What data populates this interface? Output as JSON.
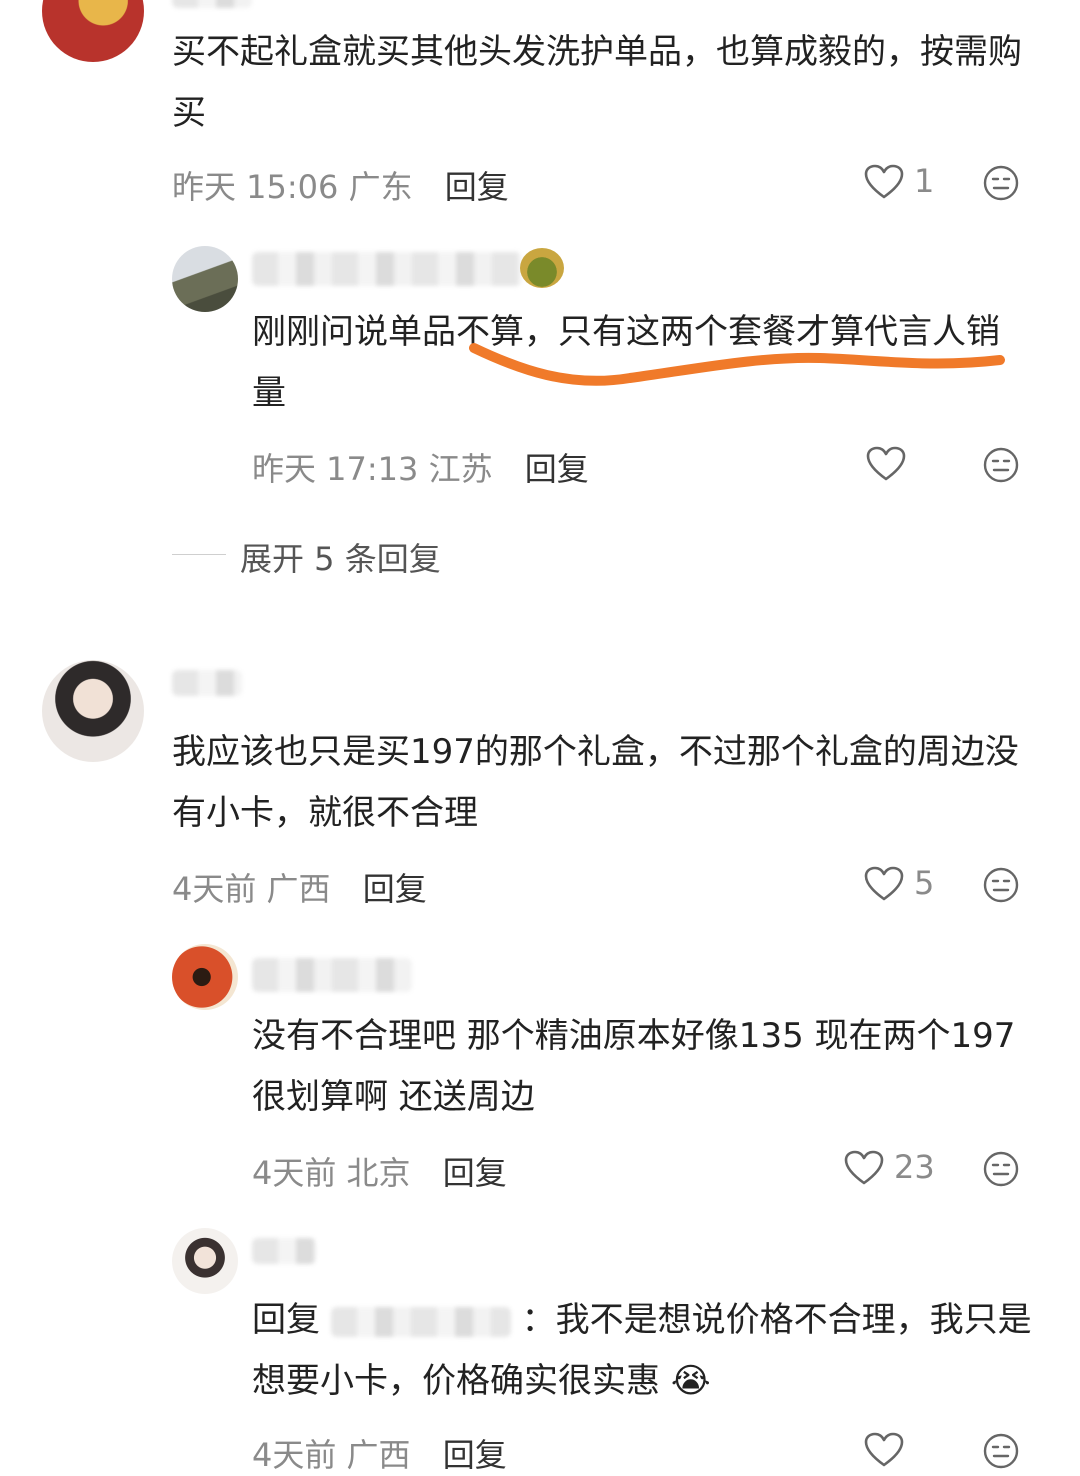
{
  "comments": [
    {
      "text": "买不起礼盒就买其他头发洗护单品，也算成毅的，按需购买",
      "time": "昨天 15:06",
      "region": "广东",
      "reply_label": "回复",
      "likes": "1"
    },
    {
      "text": "刚刚问说单品不算，只有这两个套餐才算代言人销量",
      "time": "昨天 17:13",
      "region": "江苏",
      "reply_label": "回复",
      "likes": ""
    },
    {
      "text": "我应该也只是买197的那个礼盒，不过那个礼盒的周边没有小卡，就很不合理",
      "time": "4天前",
      "region": "广西",
      "reply_label": "回复",
      "likes": "5"
    },
    {
      "text": "没有不合理吧 那个精油原本好像135 现在两个197很划算啊 还送周边",
      "time": "4天前",
      "region": "北京",
      "reply_label": "回复",
      "likes": "23"
    },
    {
      "text_prefix": "回复",
      "text_body": "：我不是想说价格不合理，我只是想要小卡，价格确实很实惠",
      "emoji": "😭",
      "time": "4天前",
      "region": "广西",
      "reply_label": "回复"
    }
  ],
  "expand_replies": "展开 5 条回复",
  "colors": {
    "text": "#222222",
    "meta": "#8a8a8a",
    "highlight_stroke": "#f07a2a"
  },
  "icons": [
    "heart-icon",
    "emoji-face-icon"
  ]
}
